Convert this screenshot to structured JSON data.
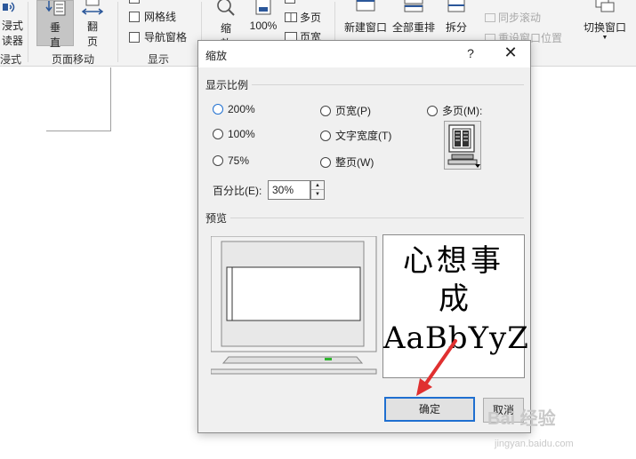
{
  "ribbon": {
    "reading_mode": {
      "line1": "浸式",
      "line2": "读器",
      "group": "浸式"
    },
    "vertical": {
      "line1": "垂",
      "line2": "直"
    },
    "flip": {
      "line1": "翻",
      "line2": "页"
    },
    "page_move_group": "页面移动",
    "gridlines": "网格线",
    "nav_pane": "导航窗格",
    "show_group": "显示",
    "zoom": {
      "line1": "缩",
      "line2": "放"
    },
    "zoom100": "100%",
    "multi_page": "多页",
    "page_width": "页宽",
    "new_window": "新建窗口",
    "arrange_all": "全部重排",
    "split": "拆分",
    "sync_scroll": "同步滚动",
    "reset_window": "重设窗口位置",
    "switch_window": "切换窗口"
  },
  "dialog": {
    "title": "缩放",
    "help": "?",
    "close": "✕",
    "zoom_section": "显示比例",
    "options": {
      "p200": "200%",
      "p100": "100%",
      "p75": "75%",
      "page_width": "页宽(P)",
      "text_width": "文字宽度(T)",
      "whole_page": "整页(W)",
      "many_pages": "多页(M):"
    },
    "selected": "200%",
    "percent_label": "百分比(E):",
    "percent_value": "30%",
    "preview_section": "预览",
    "preview_text": {
      "line1": "心想事",
      "line2": "成",
      "line3": "AaBbYyZ"
    },
    "ok": "确定",
    "cancel": "取消"
  },
  "watermark": {
    "brand": "Bai 经验",
    "url": "jingyan.baidu.com"
  },
  "colors": {
    "accent": "#1f6fd0",
    "dialog_bg": "#f0f0f0",
    "ribbon_bg": "#f3f3f3",
    "arrow": "#e03030"
  }
}
